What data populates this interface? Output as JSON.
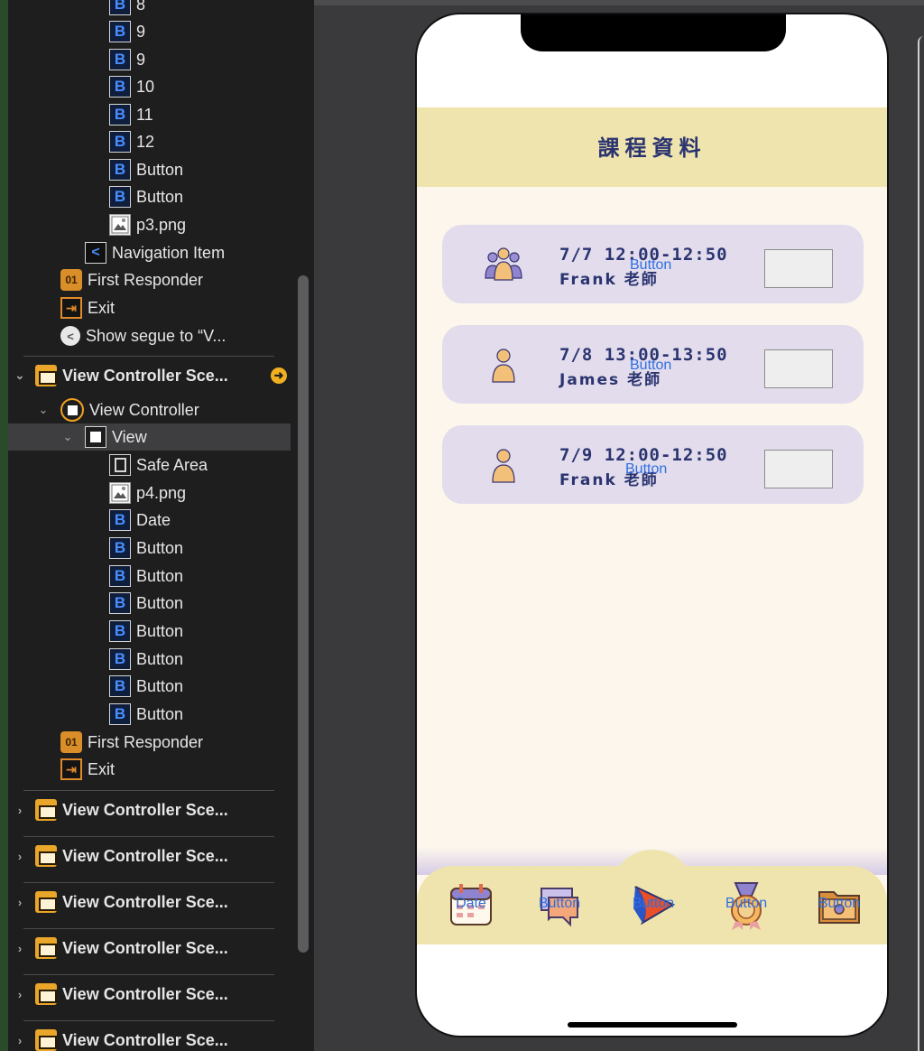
{
  "outline": {
    "items": [
      {
        "label": "8",
        "type": "button"
      },
      {
        "label": "9",
        "type": "button"
      },
      {
        "label": "9",
        "type": "button"
      },
      {
        "label": "10",
        "type": "button"
      },
      {
        "label": "11",
        "type": "button"
      },
      {
        "label": "12",
        "type": "button"
      },
      {
        "label": "Button",
        "type": "button"
      },
      {
        "label": "Button",
        "type": "button"
      },
      {
        "label": "p3.png",
        "type": "image"
      },
      {
        "label": "Navigation Item",
        "type": "nav"
      },
      {
        "label": "First Responder",
        "type": "cube"
      },
      {
        "label": "Exit",
        "type": "exit"
      },
      {
        "label": "Show segue to “V...",
        "type": "segue"
      }
    ],
    "scene": {
      "title": "View Controller Sce...",
      "controller": "View Controller",
      "view": "View",
      "children": [
        {
          "label": "Safe Area",
          "type": "safe"
        },
        {
          "label": "p4.png",
          "type": "image"
        },
        {
          "label": "Date",
          "type": "button"
        },
        {
          "label": "Button",
          "type": "button"
        },
        {
          "label": "Button",
          "type": "button"
        },
        {
          "label": "Button",
          "type": "button"
        },
        {
          "label": "Button",
          "type": "button"
        },
        {
          "label": "Button",
          "type": "button"
        },
        {
          "label": "Button",
          "type": "button"
        },
        {
          "label": "Button",
          "type": "button"
        }
      ],
      "responder": "First Responder",
      "exit": "Exit"
    },
    "collapsed_scenes": [
      "View Controller Sce...",
      "View Controller Sce...",
      "View Controller Sce...",
      "View Controller Sce...",
      "View Controller Sce...",
      "View Controller Sce..."
    ],
    "icon_glyphs": {
      "button": "B",
      "nav": "<",
      "segue": "<",
      "cube": "01",
      "exit": "⇥"
    }
  },
  "phone": {
    "header_title": "課程資料",
    "cards": [
      {
        "date_time": "7/7  12:00-12:50",
        "teacher": "Frank 老師",
        "overlay_label": "Button",
        "icon": "group-icon"
      },
      {
        "date_time": "7/8  13:00-13:50",
        "teacher": "James 老師",
        "overlay_label": "Button",
        "icon": "person-icon"
      },
      {
        "date_time": "7/9  12:00-12:50",
        "teacher": "Frank 老師",
        "overlay_label": "Button",
        "icon": "person-icon"
      }
    ],
    "tabs": [
      {
        "label": "Date",
        "icon": "calendar-icon"
      },
      {
        "label": "Button",
        "icon": "chat-icon"
      },
      {
        "label": "Button",
        "icon": "play-icon"
      },
      {
        "label": "Button",
        "icon": "medal-icon"
      },
      {
        "label": "Button",
        "icon": "folder-icon"
      }
    ]
  },
  "colors": {
    "header_bg": "#efe4ad",
    "card_bg": "#e2dcec",
    "title_text": "#2b3470",
    "overlay_blue": "#2f6fe0",
    "screen_bg": "#fcf6ec"
  }
}
